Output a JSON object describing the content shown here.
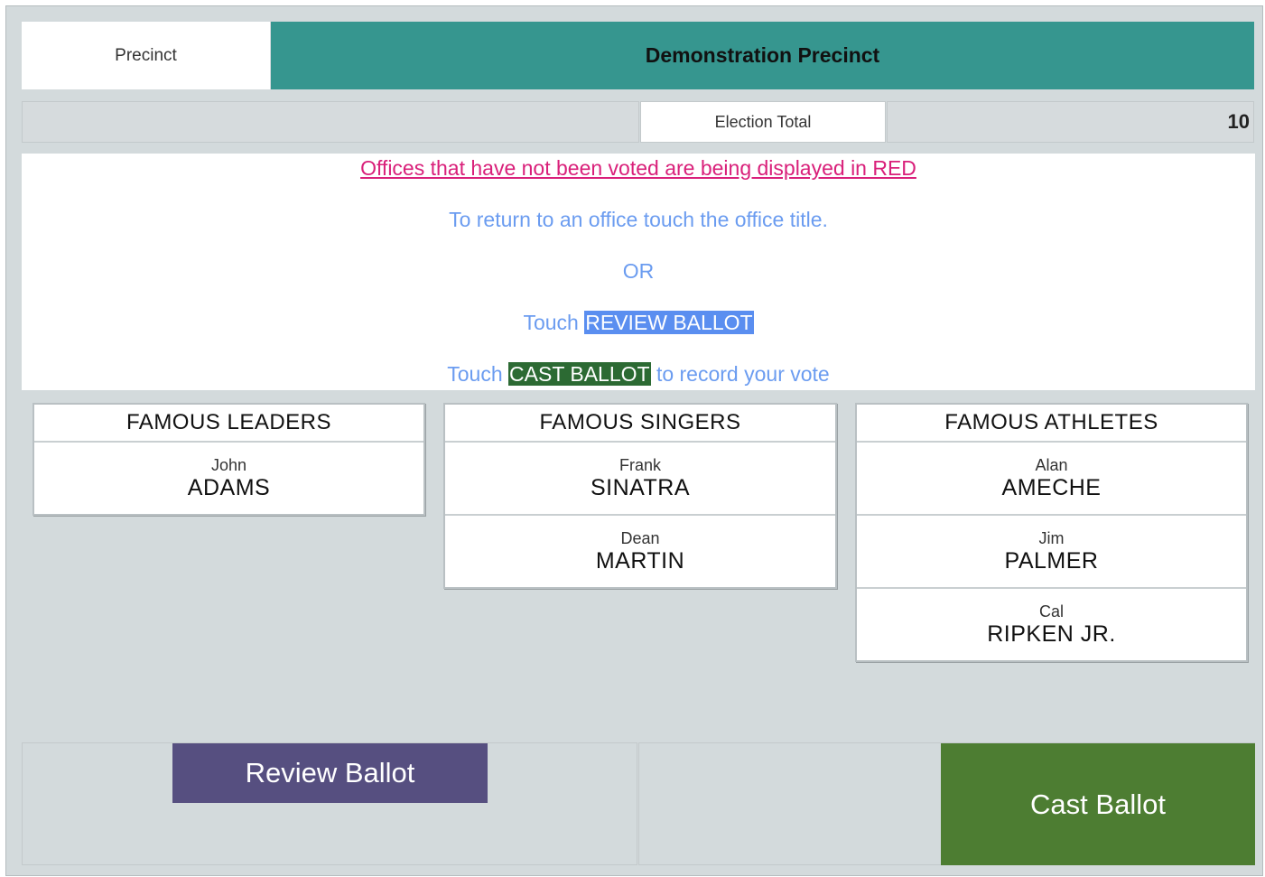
{
  "header": {
    "precinct_label": "Precinct",
    "precinct_name": "Demonstration Precinct",
    "election_total_label": "Election Total",
    "election_total_value": "10"
  },
  "instructions": {
    "warning": "Offices that have not been voted are being displayed in RED",
    "return_hint": "To return to an office touch the office title.",
    "or": "OR",
    "touch_prefix": "Touch",
    "review_highlight": "REVIEW BALLOT",
    "cast_highlight": "CAST BALLOT",
    "cast_suffix": "to record your vote"
  },
  "contests": [
    {
      "title": "FAMOUS LEADERS",
      "candidates": [
        {
          "first": "John",
          "last": "ADAMS"
        }
      ]
    },
    {
      "title": "FAMOUS SINGERS",
      "candidates": [
        {
          "first": "Frank",
          "last": "SINATRA"
        },
        {
          "first": "Dean",
          "last": "MARTIN"
        }
      ]
    },
    {
      "title": "FAMOUS ATHLETES",
      "candidates": [
        {
          "first": "Alan",
          "last": "AMECHE"
        },
        {
          "first": "Jim",
          "last": "PALMER"
        },
        {
          "first": "Cal",
          "last": "RIPKEN JR."
        }
      ]
    }
  ],
  "buttons": {
    "review": "Review Ballot",
    "cast": "Cast Ballot"
  },
  "colors": {
    "precinct_bar": "#36968f",
    "review_button": "#564f80",
    "cast_button": "#4d7d32",
    "warning_text": "#d9207a",
    "instruction_text": "#6b9cf0"
  }
}
